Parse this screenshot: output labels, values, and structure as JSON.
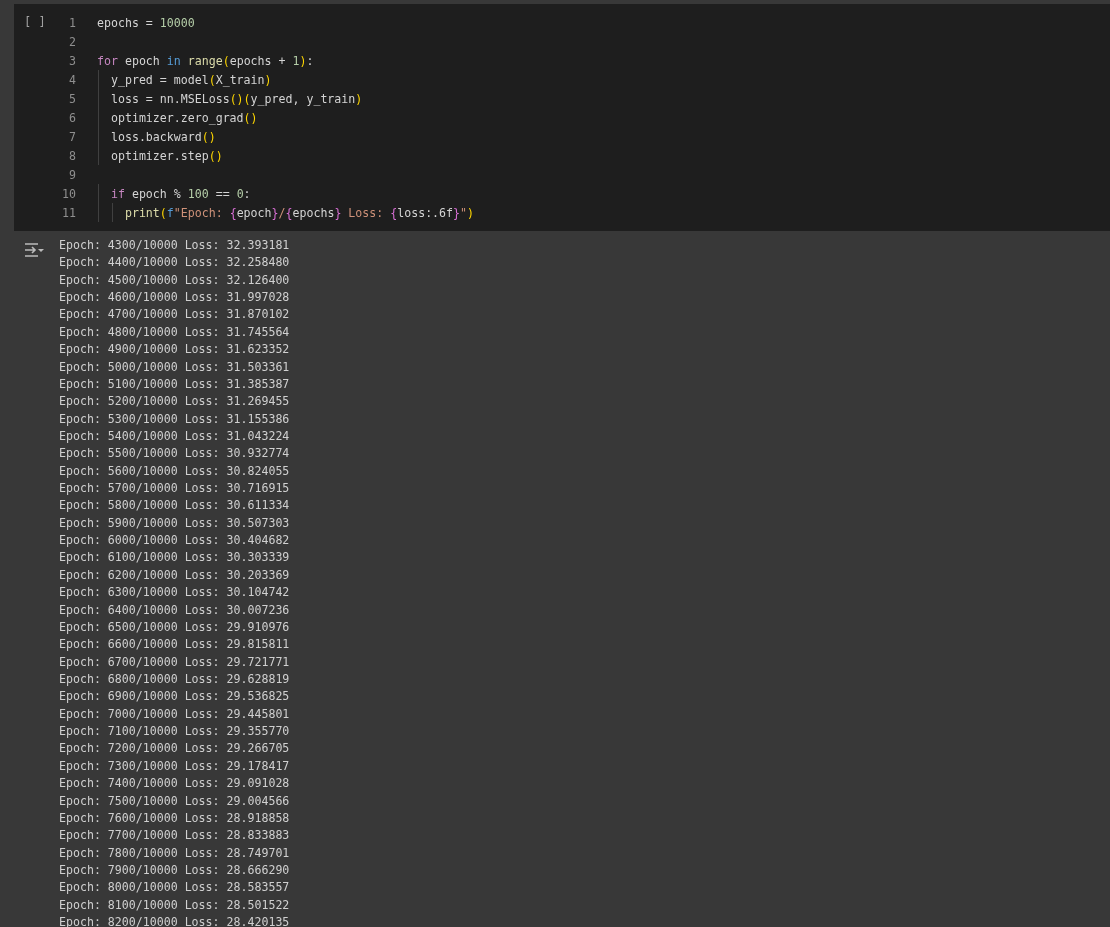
{
  "cell": {
    "run_button": "[ ]",
    "code": [
      {
        "number": "1",
        "tokens": [
          {
            "kind": "plain",
            "text": "epochs = "
          },
          {
            "kind": "number",
            "text": "10000"
          }
        ]
      },
      {
        "number": "2"
      },
      {
        "number": "3",
        "tokens": [
          {
            "kind": "keyword",
            "text": "for"
          },
          {
            "kind": "plain",
            "text": " epoch "
          },
          {
            "kind": "operator",
            "text": "in"
          },
          {
            "kind": "function",
            "text": " range"
          },
          {
            "kind": "paren",
            "text": "("
          },
          {
            "kind": "plain",
            "text": "epochs + "
          },
          {
            "kind": "number",
            "text": "1"
          },
          {
            "kind": "paren",
            "text": ")"
          },
          {
            "kind": "plain",
            "text": ":"
          }
        ]
      },
      {
        "number": "4",
        "tokens": [
          {
            "kind": "plain",
            "text": "  y_pred = model"
          },
          {
            "kind": "paren",
            "text": "("
          },
          {
            "kind": "plain",
            "text": "X_train"
          },
          {
            "kind": "paren",
            "text": ")"
          }
        ]
      },
      {
        "number": "5",
        "tokens": [
          {
            "kind": "plain",
            "text": "  loss = nn.MSELoss"
          },
          {
            "kind": "paren",
            "text": "()("
          },
          {
            "kind": "plain",
            "text": "y_pred, y_train"
          },
          {
            "kind": "paren",
            "text": ")"
          }
        ]
      },
      {
        "number": "6",
        "tokens": [
          {
            "kind": "plain",
            "text": "  optimizer.zero_grad"
          },
          {
            "kind": "paren",
            "text": "()"
          }
        ]
      },
      {
        "number": "7",
        "tokens": [
          {
            "kind": "plain",
            "text": "  loss.backward"
          },
          {
            "kind": "paren",
            "text": "()"
          }
        ]
      },
      {
        "number": "8",
        "tokens": [
          {
            "kind": "plain",
            "text": "  optimizer.step"
          },
          {
            "kind": "paren",
            "text": "()"
          }
        ]
      },
      {
        "number": "9"
      },
      {
        "number": "10",
        "tokens": [
          {
            "kind": "keyword",
            "text": "  if"
          },
          {
            "kind": "plain",
            "text": " epoch % "
          },
          {
            "kind": "number",
            "text": "100"
          },
          {
            "kind": "plain",
            "text": " == "
          },
          {
            "kind": "number",
            "text": "0"
          },
          {
            "kind": "plain",
            "text": ":"
          }
        ]
      },
      {
        "number": "11",
        "tokens": [
          {
            "kind": "function",
            "text": "    print"
          },
          {
            "kind": "paren",
            "text": "("
          },
          {
            "kind": "operator",
            "text": "f"
          },
          {
            "kind": "string",
            "text": "\"Epoch: "
          },
          {
            "kind": "brace",
            "text": "{"
          },
          {
            "kind": "plain",
            "text": "epoch"
          },
          {
            "kind": "brace",
            "text": "}"
          },
          {
            "kind": "string",
            "text": "/"
          },
          {
            "kind": "brace",
            "text": "{"
          },
          {
            "kind": "plain",
            "text": "epochs"
          },
          {
            "kind": "brace",
            "text": "}"
          },
          {
            "kind": "string",
            "text": " Loss: "
          },
          {
            "kind": "brace",
            "text": "{"
          },
          {
            "kind": "plain",
            "text": "loss:.6f"
          },
          {
            "kind": "brace",
            "text": "}"
          },
          {
            "kind": "string",
            "text": "\""
          },
          {
            "kind": "paren",
            "text": ")"
          }
        ]
      }
    ]
  },
  "output": {
    "lines": [
      "Epoch: 4300/10000 Loss: 32.393181",
      "Epoch: 4400/10000 Loss: 32.258480",
      "Epoch: 4500/10000 Loss: 32.126400",
      "Epoch: 4600/10000 Loss: 31.997028",
      "Epoch: 4700/10000 Loss: 31.870102",
      "Epoch: 4800/10000 Loss: 31.745564",
      "Epoch: 4900/10000 Loss: 31.623352",
      "Epoch: 5000/10000 Loss: 31.503361",
      "Epoch: 5100/10000 Loss: 31.385387",
      "Epoch: 5200/10000 Loss: 31.269455",
      "Epoch: 5300/10000 Loss: 31.155386",
      "Epoch: 5400/10000 Loss: 31.043224",
      "Epoch: 5500/10000 Loss: 30.932774",
      "Epoch: 5600/10000 Loss: 30.824055",
      "Epoch: 5700/10000 Loss: 30.716915",
      "Epoch: 5800/10000 Loss: 30.611334",
      "Epoch: 5900/10000 Loss: 30.507303",
      "Epoch: 6000/10000 Loss: 30.404682",
      "Epoch: 6100/10000 Loss: 30.303339",
      "Epoch: 6200/10000 Loss: 30.203369",
      "Epoch: 6300/10000 Loss: 30.104742",
      "Epoch: 6400/10000 Loss: 30.007236",
      "Epoch: 6500/10000 Loss: 29.910976",
      "Epoch: 6600/10000 Loss: 29.815811",
      "Epoch: 6700/10000 Loss: 29.721771",
      "Epoch: 6800/10000 Loss: 29.628819",
      "Epoch: 6900/10000 Loss: 29.536825",
      "Epoch: 7000/10000 Loss: 29.445801",
      "Epoch: 7100/10000 Loss: 29.355770",
      "Epoch: 7200/10000 Loss: 29.266705",
      "Epoch: 7300/10000 Loss: 29.178417",
      "Epoch: 7400/10000 Loss: 29.091028",
      "Epoch: 7500/10000 Loss: 29.004566",
      "Epoch: 7600/10000 Loss: 28.918858",
      "Epoch: 7700/10000 Loss: 28.833883",
      "Epoch: 7800/10000 Loss: 28.749701",
      "Epoch: 7900/10000 Loss: 28.666290",
      "Epoch: 8000/10000 Loss: 28.583557",
      "Epoch: 8100/10000 Loss: 28.501522",
      "Epoch: 8200/10000 Loss: 28.420135"
    ]
  }
}
